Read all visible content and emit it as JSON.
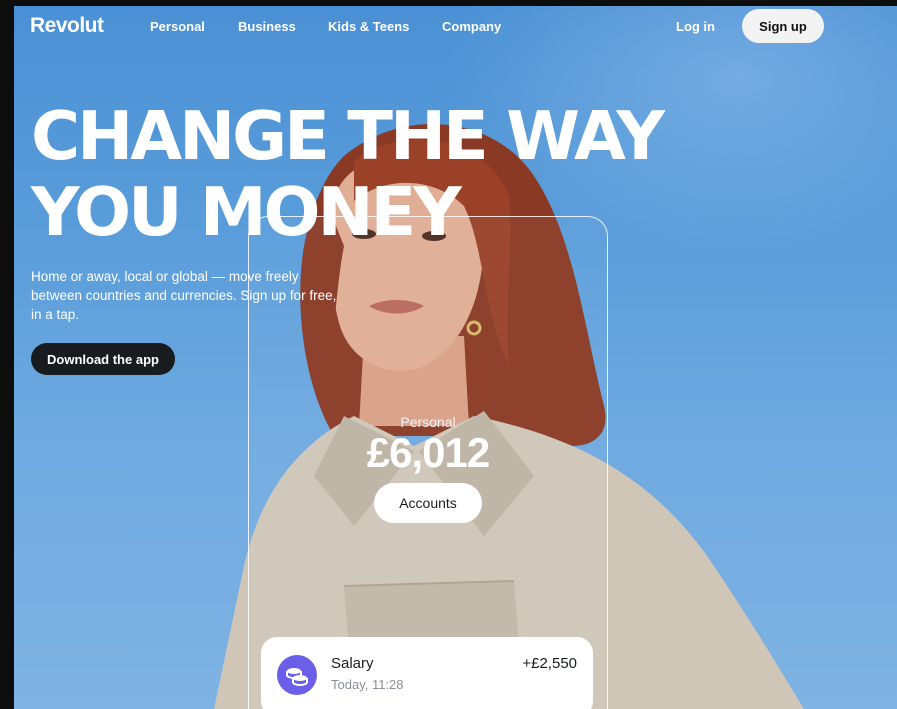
{
  "nav": {
    "logo": "Revolut",
    "links": [
      "Personal",
      "Business",
      "Kids & Teens",
      "Company"
    ],
    "login": "Log in",
    "signup": "Sign up"
  },
  "hero": {
    "title_line1": "CHANGE THE WAY",
    "title_line2": "YOU MONEY",
    "subtitle": "Home or away, local or global — move freely between countries and currencies. Sign up for free, in a tap.",
    "cta": "Download the app"
  },
  "phone": {
    "account_label": "Personal",
    "balance": "£6,012",
    "accounts_button": "Accounts",
    "transaction": {
      "title": "Salary",
      "time": "Today, 11:28",
      "amount": "+£2,550",
      "icon": "coins-icon"
    }
  },
  "colors": {
    "sky": "#5b9edb",
    "dark_button": "#191c1f",
    "accent": "#6b5ee8"
  }
}
